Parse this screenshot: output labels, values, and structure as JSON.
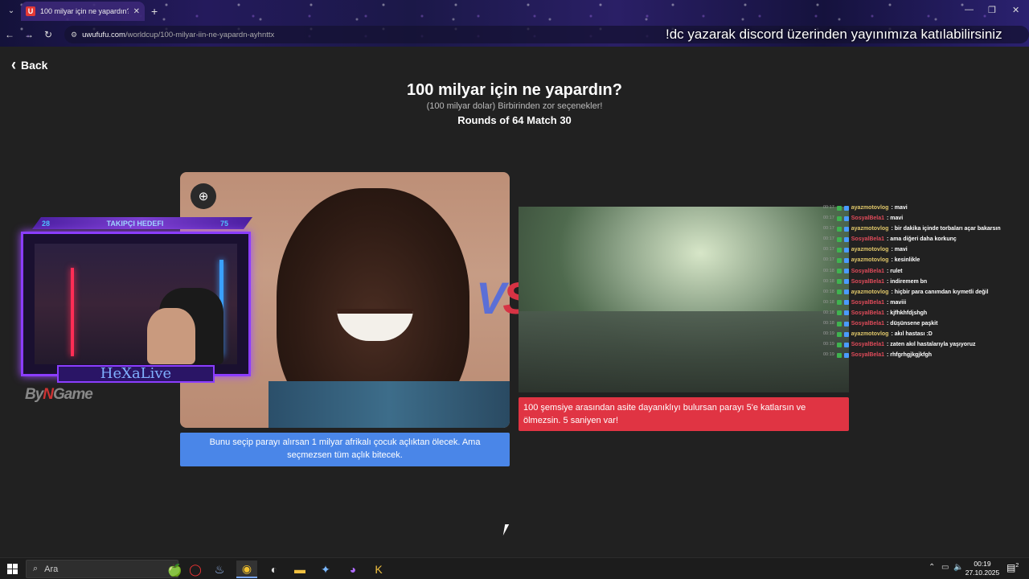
{
  "browser": {
    "tab_title": "100 milyar için ne yapardın? | U",
    "favicon_letter": "U",
    "url_domain": "uwufufu.com",
    "url_path": "/worldcup/100-milyar-iin-ne-yapardn-ayhnttx",
    "marquee": "!dc yazarak discord üzerinden yayınımıza katılabilirsiniz"
  },
  "page": {
    "back_label": "Back",
    "title": "100 milyar için ne yapardın?",
    "subtitle": "(100 milyar dolar) Birbirinden zor seçenekler!",
    "round": "Rounds of 64 Match 30",
    "vs_v": "V",
    "vs_s": "S",
    "left_caption": "Bunu seçip parayı alırsan 1 milyar afrikalı çocuk açlıktan ölecek. Ama seçmezsen tüm açlık bitecek.",
    "right_caption": "100 şemsiye arasından asite dayanıklıyı bulursan parayı 5'e katlarsın ve ölmezsin. 5 saniyen var!"
  },
  "stream_overlay": {
    "goal_current": "28",
    "goal_label": "TAKIPÇI HEDEFI",
    "goal_target": "75",
    "streamer_name": "HeXaLive",
    "brand_pre": "By",
    "brand_n": "N",
    "brand_post": "Game"
  },
  "chat": [
    {
      "time": "00:17",
      "user": "ayazmotovlog",
      "color": "y",
      "msg": "mavi"
    },
    {
      "time": "00:17",
      "user": "SosyalBela1",
      "color": "r",
      "msg": "mavi"
    },
    {
      "time": "00:17",
      "user": "ayazmotovlog",
      "color": "y",
      "msg": "bir dakika içinde torbaları açar bakarsın"
    },
    {
      "time": "00:17",
      "user": "SosyalBela1",
      "color": "r",
      "msg": "ama diğeri daha korkunç"
    },
    {
      "time": "00:17",
      "user": "ayazmotovlog",
      "color": "y",
      "msg": "mavi"
    },
    {
      "time": "00:17",
      "user": "ayazmotovlog",
      "color": "y",
      "msg": "kesinlikle"
    },
    {
      "time": "00:18",
      "user": "SosyalBela1",
      "color": "r",
      "msg": "rulet"
    },
    {
      "time": "00:18",
      "user": "SosyalBela1",
      "color": "r",
      "msg": "indiremem bn"
    },
    {
      "time": "00:18",
      "user": "ayazmotovlog",
      "color": "y",
      "msg": "hiçbir para canımdan kıymetli değil"
    },
    {
      "time": "00:18",
      "user": "SosyalBela1",
      "color": "r",
      "msg": "maviii"
    },
    {
      "time": "00:18",
      "user": "SosyalBela1",
      "color": "r",
      "msg": "kjfhkhfdjshgh"
    },
    {
      "time": "00:18",
      "user": "SosyalBela1",
      "color": "r",
      "msg": "düşünsene paşkit"
    },
    {
      "time": "00:19",
      "user": "ayazmotovlog",
      "color": "y",
      "msg": "akıl hastası :D"
    },
    {
      "time": "00:19",
      "user": "SosyalBela1",
      "color": "r",
      "msg": "zaten akıl hastalarıyla yaşıyoruz"
    },
    {
      "time": "00:19",
      "user": "SosyalBela1",
      "color": "r",
      "msg": "rhfgrhgjkgjkfgh"
    }
  ],
  "taskbar": {
    "search_placeholder": "Ara",
    "time": "00:19",
    "date": "27.10.2025",
    "notif_count": "2"
  },
  "colors": {
    "left_caption_bg": "#4a86e8",
    "right_caption_bg": "#e03443",
    "vs_v": "#5b6fd6",
    "vs_s": "#d63344"
  }
}
